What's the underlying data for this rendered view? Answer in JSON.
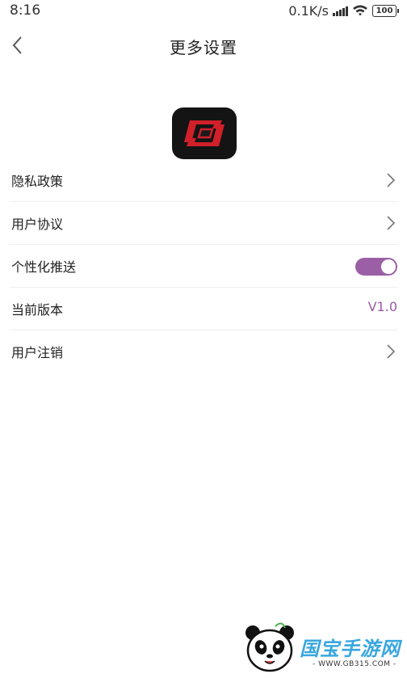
{
  "status_bar": {
    "time": "8:16",
    "net_speed": "0.1K/s",
    "battery": "100"
  },
  "header": {
    "title": "更多设置",
    "back_icon": "chevron-left-icon"
  },
  "logo": {
    "icon": "app-logo-icon",
    "accent_color": "#d0202a",
    "background_color": "#141414"
  },
  "settings": {
    "privacy_policy": {
      "label": "隐私政策",
      "icon": "chevron-right-icon"
    },
    "user_agreement": {
      "label": "用户协议",
      "icon": "chevron-right-icon"
    },
    "personalized_push": {
      "label": "个性化推送",
      "enabled": true,
      "toggle_color": "#9b5fa5"
    },
    "current_version": {
      "label": "当前版本",
      "value": "V1.0"
    },
    "account_deletion": {
      "label": "用户注销",
      "icon": "chevron-right-icon"
    }
  },
  "watermark": {
    "brand": "国宝手游网",
    "url": "- WWW.GB315.COM -"
  }
}
